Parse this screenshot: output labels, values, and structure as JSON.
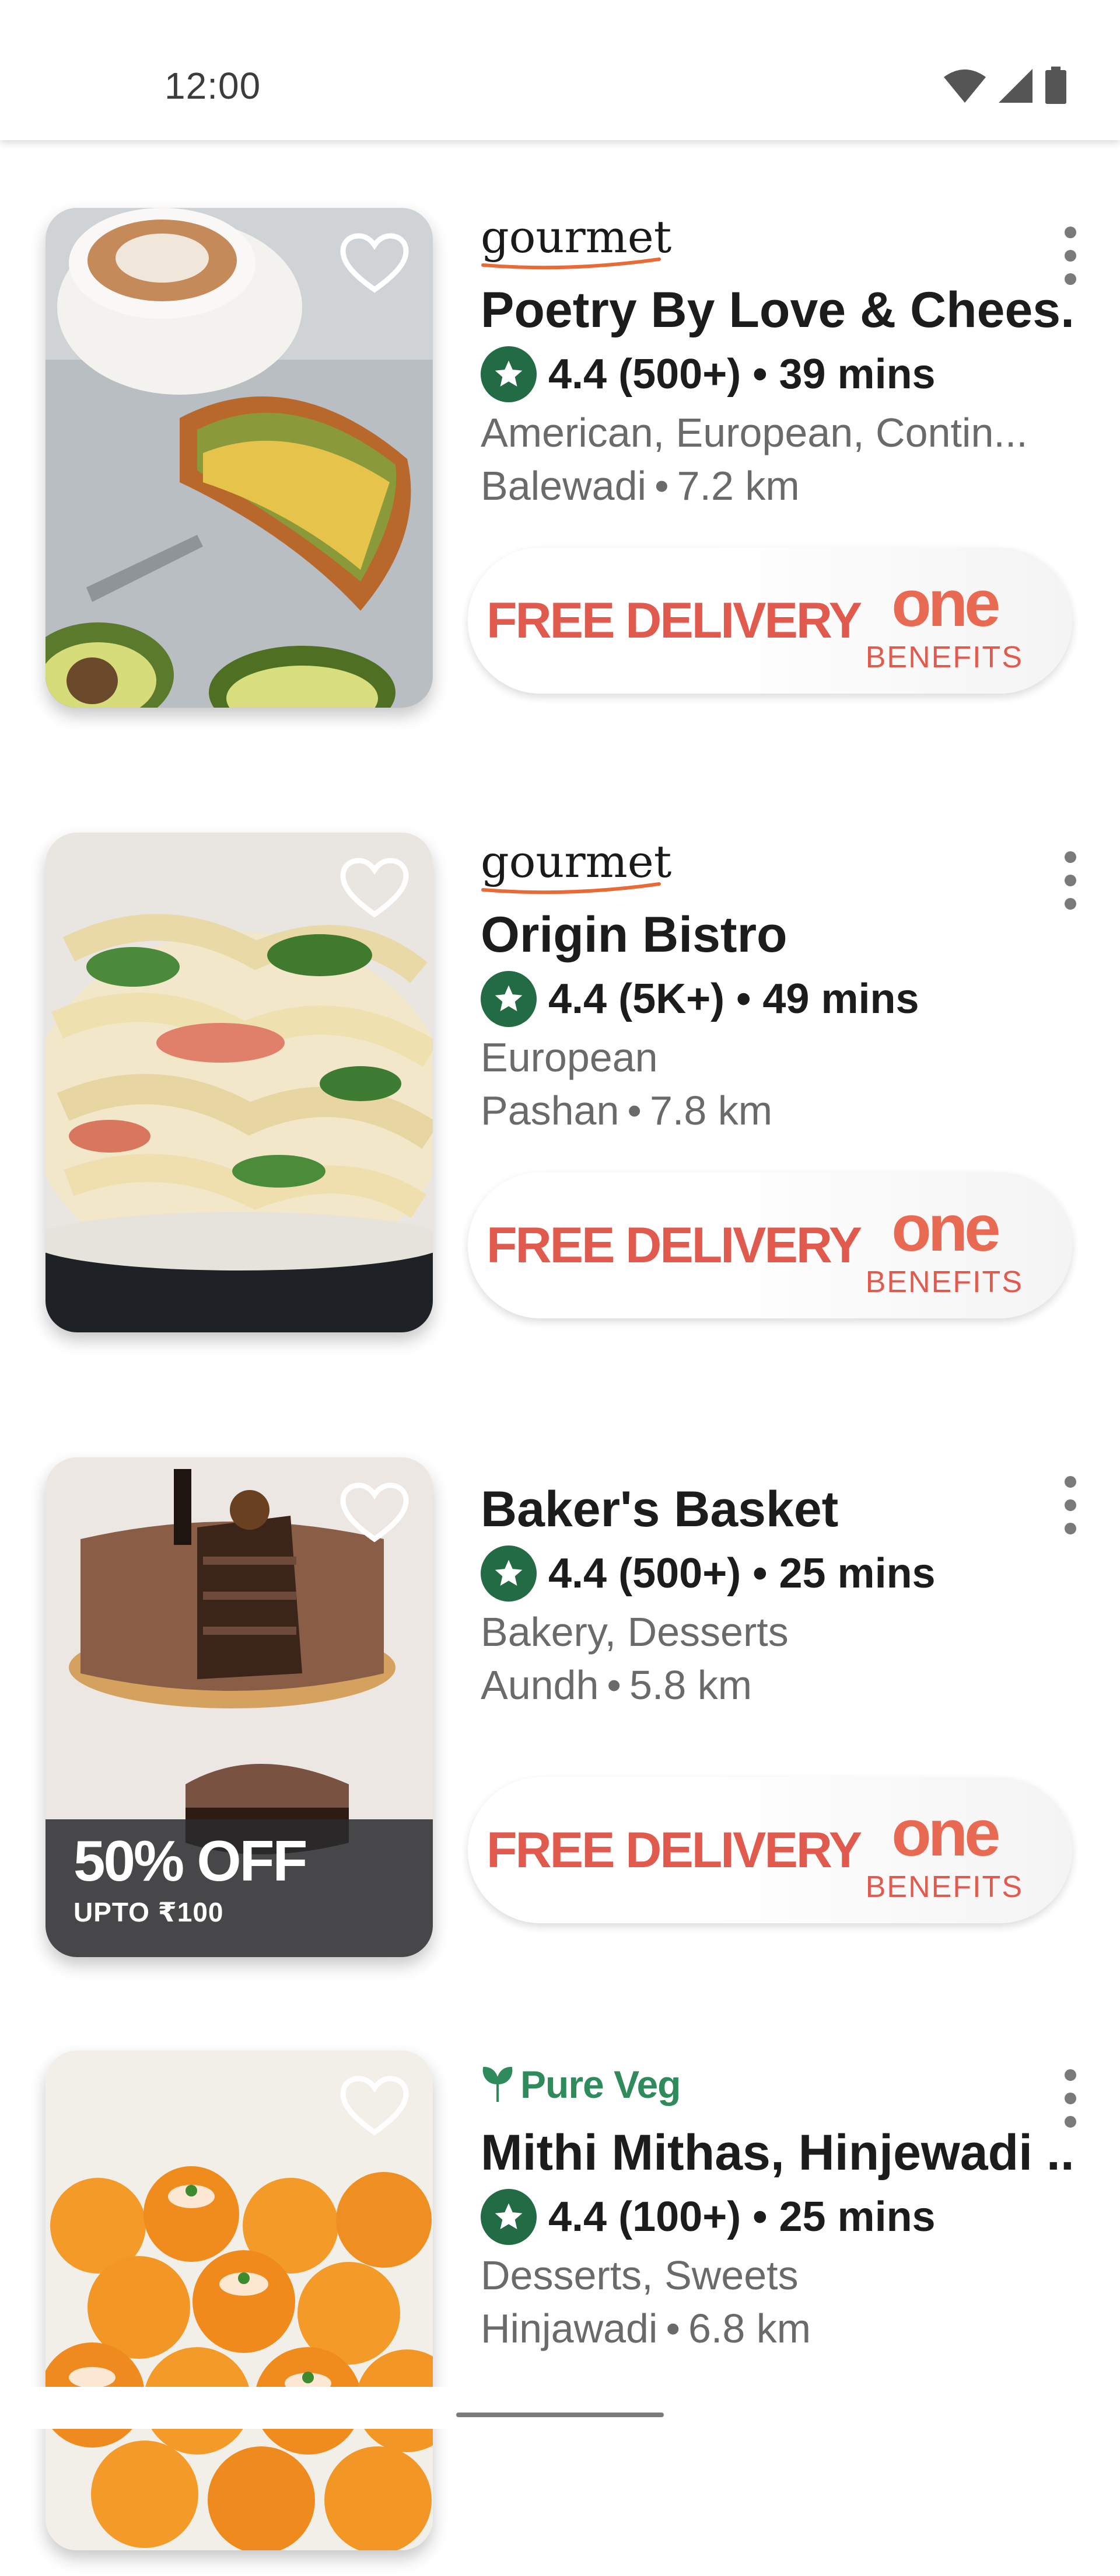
{
  "status_bar": {
    "time": "12:00"
  },
  "restaurants": [
    {
      "tag": "gourmet",
      "name": "Poetry By Love & Chees...",
      "rating": "4.4 (500+)",
      "time": "39 mins",
      "cuisines": "American, European, Contin...",
      "locality": "Balewadi",
      "distance": "7.2 km",
      "benefit": {
        "label": "FREE DELIVERY",
        "brand": "one",
        "brand_sub": "BENEFITS"
      }
    },
    {
      "tag": "gourmet",
      "name": "Origin Bistro",
      "rating": "4.4 (5K+)",
      "time": "49 mins",
      "cuisines": "European",
      "locality": "Pashan",
      "distance": "7.8 km",
      "benefit": {
        "label": "FREE DELIVERY",
        "brand": "one",
        "brand_sub": "BENEFITS"
      }
    },
    {
      "name": "Baker's Basket",
      "rating": "4.4 (500+)",
      "time": "25 mins",
      "cuisines": "Bakery, Desserts",
      "locality": "Aundh",
      "distance": "5.8 km",
      "offer": {
        "main": "50% OFF",
        "sub": "UPTO ₹100"
      },
      "benefit": {
        "label": "FREE DELIVERY",
        "brand": "one",
        "brand_sub": "BENEFITS"
      }
    },
    {
      "tag": "Pure Veg",
      "name": "Mithi Mithas, Hinjewadi ...",
      "rating": "4.4 (100+)",
      "time": "25 mins",
      "cuisines": "Desserts, Sweets",
      "locality": "Hinjawadi",
      "distance": "6.8 km"
    }
  ],
  "colors": {
    "rating_badge": "#236b45",
    "free_delivery": "#e05a4e",
    "one_brand": "#e96a52",
    "pure_veg": "#2f8a5c"
  },
  "icons": [
    "wifi-icon",
    "signal-icon",
    "battery-icon",
    "heart-icon",
    "star-icon",
    "kebab-menu-icon",
    "leaf-icon"
  ]
}
